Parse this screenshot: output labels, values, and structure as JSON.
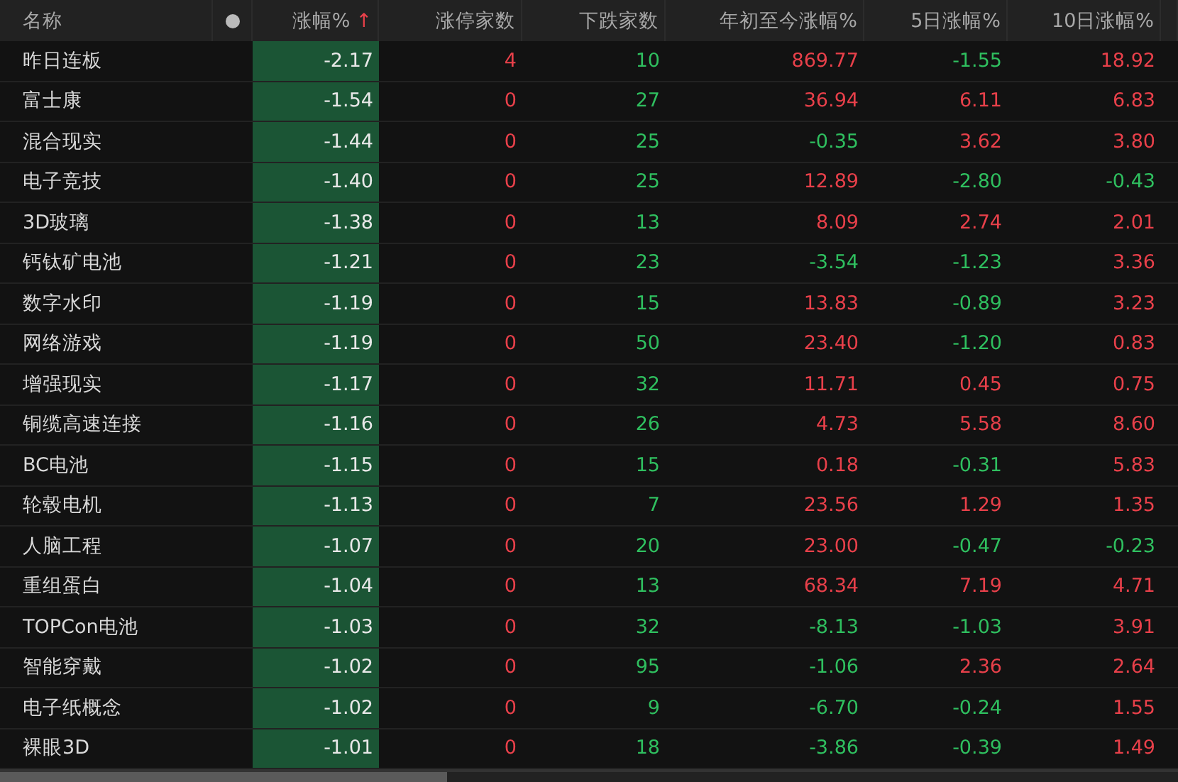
{
  "columns": [
    {
      "kind": "label",
      "label": "名称"
    },
    {
      "kind": "dot"
    },
    {
      "kind": "label",
      "label": "涨幅%",
      "sort_arrow": "↑"
    },
    {
      "kind": "label",
      "label": "涨停家数"
    },
    {
      "kind": "label",
      "label": "下跌家数"
    },
    {
      "kind": "label",
      "label": "年初至今涨幅%"
    },
    {
      "kind": "label",
      "label": "5日涨幅%"
    },
    {
      "kind": "label",
      "label": "10日涨幅%"
    }
  ],
  "rows": [
    {
      "name": "昨日连板",
      "change": "-2.17",
      "values": [
        {
          "text": "4",
          "color": "#e8404a"
        },
        {
          "text": "10",
          "color": "#2fbf5f"
        },
        {
          "text": "869.77",
          "color": "#e8404a"
        },
        {
          "text": "-1.55",
          "color": "#2fbf5f"
        },
        {
          "text": "18.92",
          "color": "#e8404a"
        }
      ]
    },
    {
      "name": "富士康",
      "change": "-1.54",
      "values": [
        {
          "text": "0",
          "color": "#e8404a"
        },
        {
          "text": "27",
          "color": "#2fbf5f"
        },
        {
          "text": "36.94",
          "color": "#e8404a"
        },
        {
          "text": "6.11",
          "color": "#e8404a"
        },
        {
          "text": "6.83",
          "color": "#e8404a"
        }
      ]
    },
    {
      "name": "混合现实",
      "change": "-1.44",
      "values": [
        {
          "text": "0",
          "color": "#e8404a"
        },
        {
          "text": "25",
          "color": "#2fbf5f"
        },
        {
          "text": "-0.35",
          "color": "#2fbf5f"
        },
        {
          "text": "3.62",
          "color": "#e8404a"
        },
        {
          "text": "3.80",
          "color": "#e8404a"
        }
      ]
    },
    {
      "name": "电子竞技",
      "change": "-1.40",
      "values": [
        {
          "text": "0",
          "color": "#e8404a"
        },
        {
          "text": "25",
          "color": "#2fbf5f"
        },
        {
          "text": "12.89",
          "color": "#e8404a"
        },
        {
          "text": "-2.80",
          "color": "#2fbf5f"
        },
        {
          "text": "-0.43",
          "color": "#2fbf5f"
        }
      ]
    },
    {
      "name": "3D玻璃",
      "change": "-1.38",
      "values": [
        {
          "text": "0",
          "color": "#e8404a"
        },
        {
          "text": "13",
          "color": "#2fbf5f"
        },
        {
          "text": "8.09",
          "color": "#e8404a"
        },
        {
          "text": "2.74",
          "color": "#e8404a"
        },
        {
          "text": "2.01",
          "color": "#e8404a"
        }
      ]
    },
    {
      "name": "钙钛矿电池",
      "change": "-1.21",
      "values": [
        {
          "text": "0",
          "color": "#e8404a"
        },
        {
          "text": "23",
          "color": "#2fbf5f"
        },
        {
          "text": "-3.54",
          "color": "#2fbf5f"
        },
        {
          "text": "-1.23",
          "color": "#2fbf5f"
        },
        {
          "text": "3.36",
          "color": "#e8404a"
        }
      ]
    },
    {
      "name": "数字水印",
      "change": "-1.19",
      "values": [
        {
          "text": "0",
          "color": "#e8404a"
        },
        {
          "text": "15",
          "color": "#2fbf5f"
        },
        {
          "text": "13.83",
          "color": "#e8404a"
        },
        {
          "text": "-0.89",
          "color": "#2fbf5f"
        },
        {
          "text": "3.23",
          "color": "#e8404a"
        }
      ]
    },
    {
      "name": "网络游戏",
      "change": "-1.19",
      "values": [
        {
          "text": "0",
          "color": "#e8404a"
        },
        {
          "text": "50",
          "color": "#2fbf5f"
        },
        {
          "text": "23.40",
          "color": "#e8404a"
        },
        {
          "text": "-1.20",
          "color": "#2fbf5f"
        },
        {
          "text": "0.83",
          "color": "#e8404a"
        }
      ]
    },
    {
      "name": "增强现实",
      "change": "-1.17",
      "values": [
        {
          "text": "0",
          "color": "#e8404a"
        },
        {
          "text": "32",
          "color": "#2fbf5f"
        },
        {
          "text": "11.71",
          "color": "#e8404a"
        },
        {
          "text": "0.45",
          "color": "#e8404a"
        },
        {
          "text": "0.75",
          "color": "#e8404a"
        }
      ]
    },
    {
      "name": "铜缆高速连接",
      "change": "-1.16",
      "values": [
        {
          "text": "0",
          "color": "#e8404a"
        },
        {
          "text": "26",
          "color": "#2fbf5f"
        },
        {
          "text": "4.73",
          "color": "#e8404a"
        },
        {
          "text": "5.58",
          "color": "#e8404a"
        },
        {
          "text": "8.60",
          "color": "#e8404a"
        }
      ]
    },
    {
      "name": "BC电池",
      "change": "-1.15",
      "values": [
        {
          "text": "0",
          "color": "#e8404a"
        },
        {
          "text": "15",
          "color": "#2fbf5f"
        },
        {
          "text": "0.18",
          "color": "#e8404a"
        },
        {
          "text": "-0.31",
          "color": "#2fbf5f"
        },
        {
          "text": "5.83",
          "color": "#e8404a"
        }
      ]
    },
    {
      "name": "轮毂电机",
      "change": "-1.13",
      "values": [
        {
          "text": "0",
          "color": "#e8404a"
        },
        {
          "text": "7",
          "color": "#2fbf5f"
        },
        {
          "text": "23.56",
          "color": "#e8404a"
        },
        {
          "text": "1.29",
          "color": "#e8404a"
        },
        {
          "text": "1.35",
          "color": "#e8404a"
        }
      ]
    },
    {
      "name": "人脑工程",
      "change": "-1.07",
      "values": [
        {
          "text": "0",
          "color": "#e8404a"
        },
        {
          "text": "20",
          "color": "#2fbf5f"
        },
        {
          "text": "23.00",
          "color": "#e8404a"
        },
        {
          "text": "-0.47",
          "color": "#2fbf5f"
        },
        {
          "text": "-0.23",
          "color": "#2fbf5f"
        }
      ]
    },
    {
      "name": "重组蛋白",
      "change": "-1.04",
      "values": [
        {
          "text": "0",
          "color": "#e8404a"
        },
        {
          "text": "13",
          "color": "#2fbf5f"
        },
        {
          "text": "68.34",
          "color": "#e8404a"
        },
        {
          "text": "7.19",
          "color": "#e8404a"
        },
        {
          "text": "4.71",
          "color": "#e8404a"
        }
      ]
    },
    {
      "name": "TOPCon电池",
      "change": "-1.03",
      "values": [
        {
          "text": "0",
          "color": "#e8404a"
        },
        {
          "text": "32",
          "color": "#2fbf5f"
        },
        {
          "text": "-8.13",
          "color": "#2fbf5f"
        },
        {
          "text": "-1.03",
          "color": "#2fbf5f"
        },
        {
          "text": "3.91",
          "color": "#e8404a"
        }
      ]
    },
    {
      "name": "智能穿戴",
      "change": "-1.02",
      "values": [
        {
          "text": "0",
          "color": "#e8404a"
        },
        {
          "text": "95",
          "color": "#2fbf5f"
        },
        {
          "text": "-1.06",
          "color": "#2fbf5f"
        },
        {
          "text": "2.36",
          "color": "#e8404a"
        },
        {
          "text": "2.64",
          "color": "#e8404a"
        }
      ]
    },
    {
      "name": "电子纸概念",
      "change": "-1.02",
      "values": [
        {
          "text": "0",
          "color": "#e8404a"
        },
        {
          "text": "9",
          "color": "#2fbf5f"
        },
        {
          "text": "-6.70",
          "color": "#2fbf5f"
        },
        {
          "text": "-0.24",
          "color": "#2fbf5f"
        },
        {
          "text": "1.55",
          "color": "#e8404a"
        }
      ]
    },
    {
      "name": "裸眼3D",
      "change": "-1.01",
      "values": [
        {
          "text": "0",
          "color": "#e8404a"
        },
        {
          "text": "18",
          "color": "#2fbf5f"
        },
        {
          "text": "-3.86",
          "color": "#2fbf5f"
        },
        {
          "text": "-0.39",
          "color": "#2fbf5f"
        },
        {
          "text": "1.49",
          "color": "#e8404a"
        }
      ]
    }
  ]
}
